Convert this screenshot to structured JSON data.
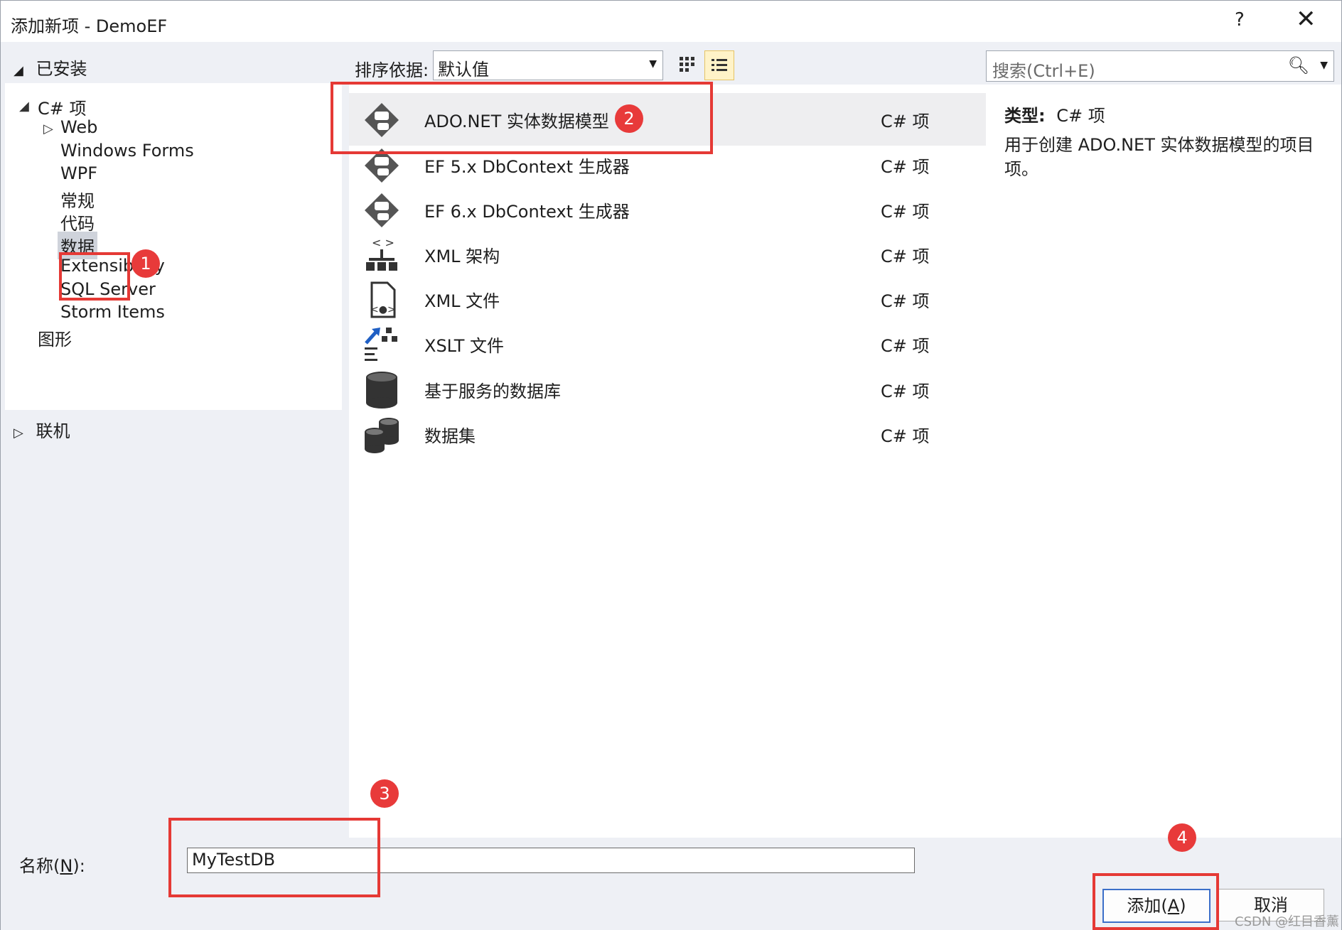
{
  "window": {
    "title": "添加新项 - DemoEF",
    "help_label": "?",
    "close_label": "✕"
  },
  "left_panel": {
    "installed_label": "已安装",
    "tree": [
      {
        "label": "C# 项"
      },
      {
        "label": "Web"
      },
      {
        "label": "Windows Forms"
      },
      {
        "label": "WPF"
      },
      {
        "label": "常规"
      },
      {
        "label": "代码"
      },
      {
        "label": "数据"
      },
      {
        "label": "Extensibility"
      },
      {
        "label": "SQL Server"
      },
      {
        "label": "Storm Items"
      },
      {
        "label": "图形"
      }
    ],
    "online_label": "联机"
  },
  "sortbar": {
    "label": "排序依据:",
    "selected": "默认值"
  },
  "search": {
    "placeholder": "搜索(Ctrl+E)"
  },
  "items": [
    {
      "name": "ADO.NET 实体数据模型",
      "type": "C# 项",
      "icon": "entity-model-icon"
    },
    {
      "name": "EF 5.x DbContext 生成器",
      "type": "C# 项",
      "icon": "entity-model-icon"
    },
    {
      "name": "EF 6.x DbContext 生成器",
      "type": "C# 项",
      "icon": "entity-model-icon"
    },
    {
      "name": "XML 架构",
      "type": "C# 项",
      "icon": "xml-schema-icon"
    },
    {
      "name": "XML 文件",
      "type": "C# 项",
      "icon": "xml-file-icon"
    },
    {
      "name": "XSLT 文件",
      "type": "C# 项",
      "icon": "xslt-icon"
    },
    {
      "name": "基于服务的数据库",
      "type": "C# 项",
      "icon": "database-icon"
    },
    {
      "name": "数据集",
      "type": "C# 项",
      "icon": "dataset-icon"
    }
  ],
  "details": {
    "type_label": "类型:",
    "type_value": "C# 项",
    "description": "用于创建 ADO.NET 实体数据模型的项目项。"
  },
  "bottom": {
    "name_label_pre": "名称(",
    "name_label_key": "N",
    "name_label_post": "):",
    "name_value": "MyTestDB",
    "add_pre": "添加(",
    "add_key": "A",
    "add_post": ")",
    "cancel": "取消"
  },
  "annotations": [
    "1",
    "2",
    "3",
    "4"
  ],
  "watermark": "CSDN @红目香薰",
  "colors": {
    "annotation_red": "#e53935",
    "selection": "#cfd3db",
    "accent_blue": "#3b6fc9"
  }
}
